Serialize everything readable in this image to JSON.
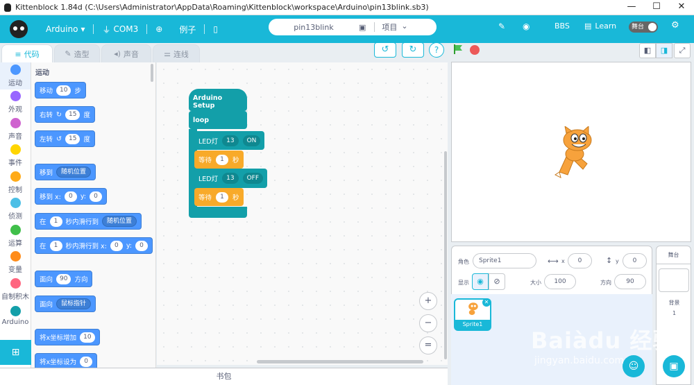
{
  "window": {
    "title": "Kittenblock 1.84d (C:\\Users\\Administrator\\AppData\\Roaming\\Kittenblock\\workspace\\Arduino\\pin13blink.sb3)",
    "controls": [
      "—",
      "☐",
      "✕"
    ]
  },
  "menubar": {
    "board": "Arduino",
    "port": "COM3",
    "lang": "例子",
    "project_name": "pin13blink",
    "project_menu": "项目",
    "bbs": "BBS",
    "learn": "Learn",
    "stage_toggle": "舞台"
  },
  "tabs": [
    {
      "label": "代码"
    },
    {
      "label": "造型"
    },
    {
      "label": "声音"
    },
    {
      "label": "连线"
    }
  ],
  "categories": [
    {
      "label": "运动",
      "color": "#4c97ff"
    },
    {
      "label": "外观",
      "color": "#9966ff"
    },
    {
      "label": "声音",
      "color": "#cf63cf"
    },
    {
      "label": "事件",
      "color": "#ffd500"
    },
    {
      "label": "控制",
      "color": "#ffab19"
    },
    {
      "label": "侦测",
      "color": "#4cbfe6"
    },
    {
      "label": "运算",
      "color": "#40bf4a"
    },
    {
      "label": "变量",
      "color": "#ff8c1a"
    },
    {
      "label": "自制积木",
      "color": "#ff6680"
    },
    {
      "label": "Arduino",
      "color": "#139fa9"
    }
  ],
  "palette": {
    "header": "运动",
    "move": {
      "t1": "移动",
      "v": "10",
      "t2": "步"
    },
    "turn_right": {
      "t1": "右转",
      "icon": "↻",
      "v": "15",
      "t2": "度"
    },
    "turn_left": {
      "t1": "左转",
      "icon": "↺",
      "v": "15",
      "t2": "度"
    },
    "goto": {
      "t1": "移到",
      "dd": "随机位置"
    },
    "goto_xy": {
      "t1": "移到 x:",
      "x": "0",
      "t2": "y:",
      "y": "0"
    },
    "glide": {
      "t1": "在",
      "v": "1",
      "t2": "秒内滑行到",
      "dd": "随机位置"
    },
    "glide_xy": {
      "t1": "在",
      "v": "1",
      "t2": "秒内滑行到 x:",
      "x": "0",
      "t3": "y:",
      "y": "0"
    },
    "point_dir": {
      "t1": "面向",
      "v": "90",
      "t2": "方向"
    },
    "point_towards": {
      "t1": "面向",
      "dd": "鼠标指针"
    },
    "change_x": {
      "t1": "将x坐标增加",
      "v": "10"
    },
    "set_x": {
      "t1": "将x坐标设为",
      "v": "0"
    }
  },
  "script": {
    "setup": "Arduino Setup",
    "loop": "loop",
    "led1": {
      "label": "LED灯",
      "pin": "13",
      "state": "ON"
    },
    "wait1": {
      "label": "等待",
      "v": "1",
      "unit": "秒"
    },
    "led2": {
      "label": "LED灯",
      "pin": "13",
      "state": "OFF"
    },
    "wait2": {
      "label": "等待",
      "v": "1",
      "unit": "秒"
    }
  },
  "zoom": {
    "in": "+",
    "out": "−",
    "reset": "="
  },
  "sprite": {
    "label_sprite": "角色",
    "name": "Sprite1",
    "x_label": "x",
    "x": "0",
    "y_label": "y",
    "y": "0",
    "show_label": "显示",
    "size_label": "大小",
    "size": "100",
    "dir_label": "方向",
    "dir": "90",
    "thumb_name": "Sprite1"
  },
  "stage_panel": {
    "title": "舞台",
    "backdrop_label": "背景",
    "backdrop_count": "1"
  },
  "bottom": {
    "backpack": "书包"
  },
  "watermark": {
    "logo": "Baiàdu 经验",
    "url": "jingyan.baidu.com"
  }
}
